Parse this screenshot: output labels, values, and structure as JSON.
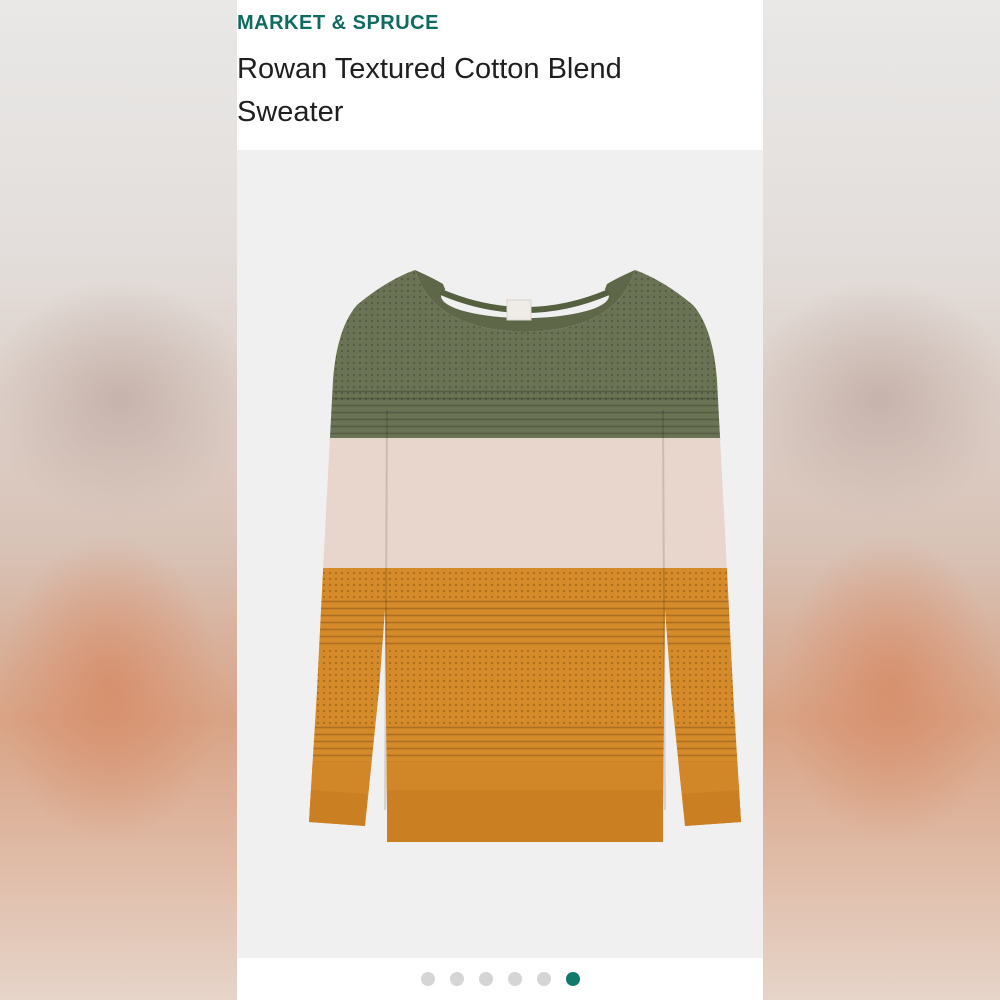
{
  "product": {
    "brand": "MARKET & SPRUCE",
    "name": "Rowan Textured Cotton Blend Sweater"
  },
  "image": {
    "description_icon": "sweater-image",
    "stripe_colors": {
      "olive": "#6b7355",
      "blush": "#e8d5cc",
      "mustard": "#d68b2a"
    }
  },
  "carousel": {
    "total": 6,
    "active_index": 5,
    "colors": {
      "inactive": "#d5d5d5",
      "active": "#0f7a6c"
    }
  }
}
